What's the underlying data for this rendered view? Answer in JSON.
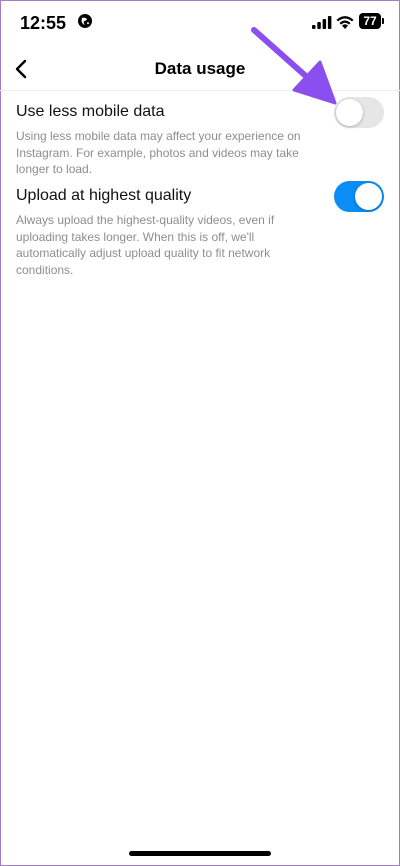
{
  "status_bar": {
    "time": "12:55",
    "battery": "77",
    "icons": [
      "globe-icon",
      "cellular-signal-icon",
      "wifi-icon",
      "battery-icon"
    ]
  },
  "header": {
    "title": "Data usage",
    "back_icon": "chevron-left-icon"
  },
  "settings": [
    {
      "title": "Use less mobile data",
      "description": "Using less mobile data may affect your experience on Instagram. For example, photos and videos may take longer to load.",
      "enabled": false
    },
    {
      "title": "Upload at highest quality",
      "description": "Always upload the highest-quality videos, even if uploading takes longer. When this is off, we'll automatically adjust upload quality to fit network conditions.",
      "enabled": true
    }
  ],
  "colors": {
    "toggle_on": "#0a8ef5",
    "toggle_off": "#e6e6e6",
    "annotation_arrow": "#8b4ff0",
    "description_text": "#8e8e8e"
  }
}
